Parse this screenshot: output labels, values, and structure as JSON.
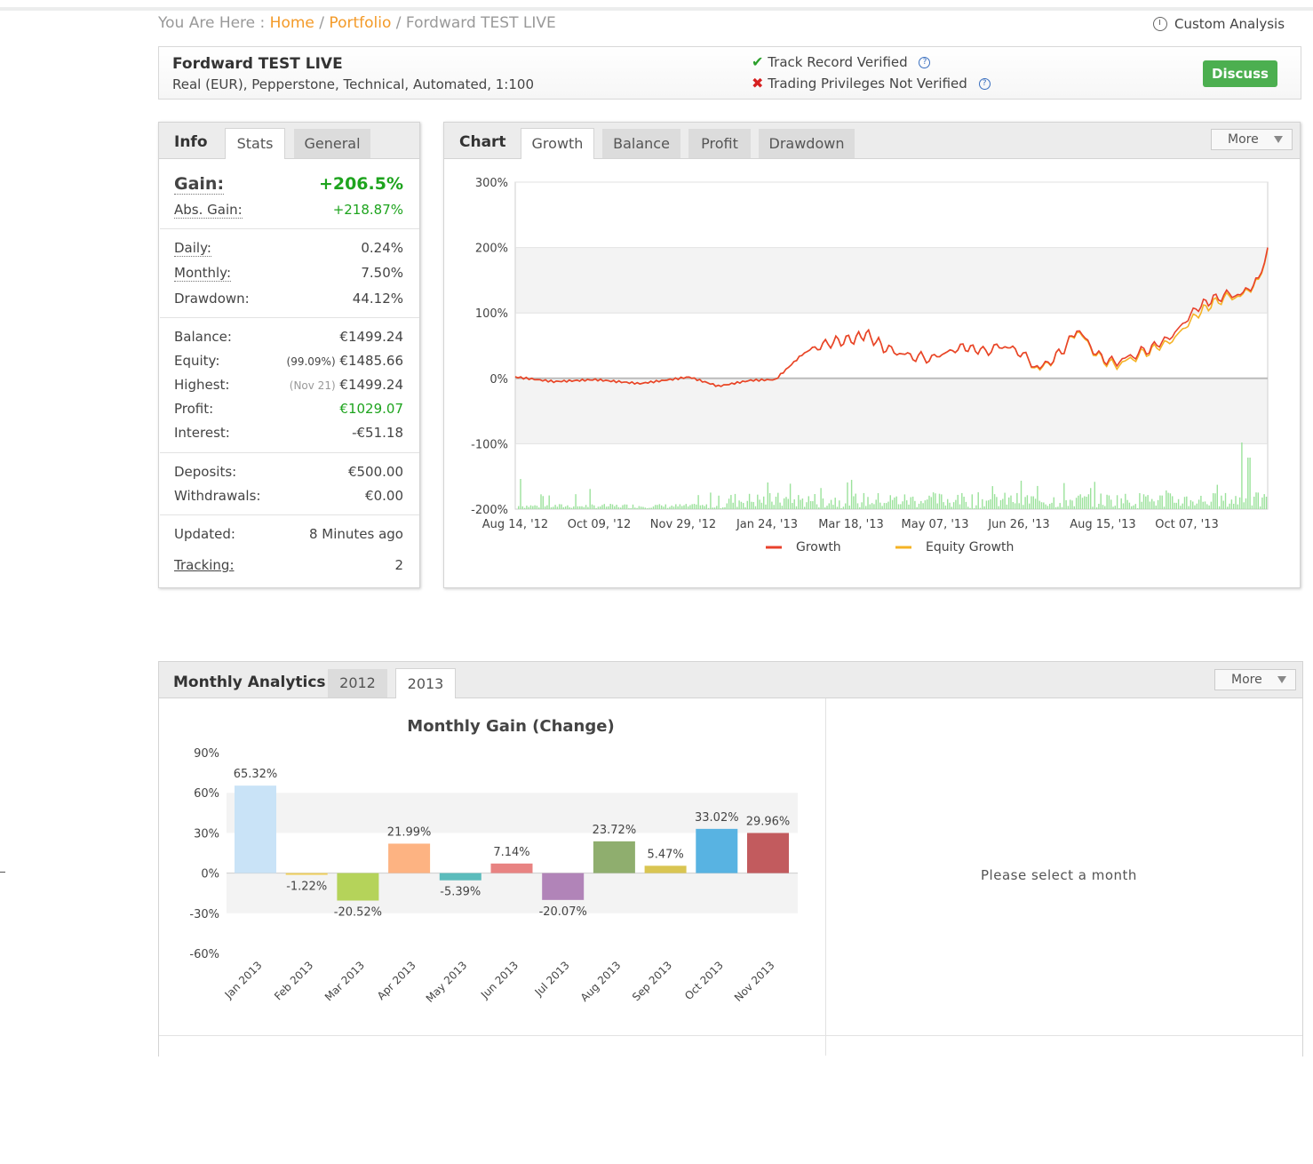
{
  "breadcrumb": {
    "prefix": "You Are Here : ",
    "home": "Home",
    "sep": " / ",
    "portfolio": "Portfolio",
    "current": "Fordward TEST LIVE"
  },
  "custom_analysis": "Custom Analysis",
  "account": {
    "name": "Fordward TEST LIVE",
    "details": "Real (EUR), Pepperstone, Technical, Automated, 1:100",
    "track_record": "Track Record Verified",
    "trading_privileges": "Trading Privileges Not Verified",
    "discuss": "Discuss"
  },
  "info_panel": {
    "tabs": [
      "Info",
      "Stats",
      "General"
    ],
    "gain_label": "Gain:",
    "gain_value": "+206.5%",
    "abs_gain_label": "Abs. Gain:",
    "abs_gain_value": "+218.87%",
    "daily_label": "Daily:",
    "daily_value": "0.24%",
    "monthly_label": "Monthly:",
    "monthly_value": "7.50%",
    "drawdown_label": "Drawdown:",
    "drawdown_value": "44.12%",
    "balance_label": "Balance:",
    "balance_value": "€1499.24",
    "equity_label": "Equity:",
    "equity_pct": "(99.09%)",
    "equity_value": "€1485.66",
    "highest_label": "Highest:",
    "highest_date": "(Nov 21)",
    "highest_value": "€1499.24",
    "profit_label": "Profit:",
    "profit_value": "€1029.07",
    "interest_label": "Interest:",
    "interest_value": "-€51.18",
    "deposits_label": "Deposits:",
    "deposits_value": "€500.00",
    "withdrawals_label": "Withdrawals:",
    "withdrawals_value": "€0.00",
    "updated_label": "Updated:",
    "updated_value": "8 Minutes ago",
    "tracking_label": "Tracking:",
    "tracking_value": "2"
  },
  "chart_panel": {
    "title": "Chart",
    "tabs": [
      "Growth",
      "Balance",
      "Profit",
      "Drawdown"
    ],
    "more": "More"
  },
  "monthly_panel": {
    "title": "Monthly Analytics",
    "tabs": [
      "2012",
      "2013"
    ],
    "more": "More",
    "placeholder": "Please select a month"
  },
  "colors": {
    "growth": "#e8412c",
    "equity": "#f5b325",
    "bar_volume": "#9be29b",
    "green": "#1ea41e",
    "orange": "#f39a28"
  },
  "chart_data": [
    {
      "type": "line",
      "x_tick_labels": [
        "Aug 14, '12",
        "Oct 09, '12",
        "Nov 29, '12",
        "Jan 24, '13",
        "Mar 18, '13",
        "May 07, '13",
        "Jun 26, '13",
        "Aug 15, '13",
        "Oct 07, '13"
      ],
      "y_tick_labels": [
        "300%",
        "200%",
        "100%",
        "0%",
        "-100%",
        "-200%"
      ],
      "ylim": [
        -200,
        300
      ],
      "series": [
        {
          "name": "Growth",
          "color": "#e8412c",
          "x": [
            "2012-07-20",
            "2012-08-14",
            "2012-09-10",
            "2012-10-09",
            "2012-10-25",
            "2012-11-10",
            "2012-11-29",
            "2012-12-20",
            "2013-01-05",
            "2013-01-24",
            "2013-02-10",
            "2013-02-25",
            "2013-03-05",
            "2013-03-18",
            "2013-04-01",
            "2013-04-15",
            "2013-05-07",
            "2013-05-20",
            "2013-06-05",
            "2013-06-15",
            "2013-06-26",
            "2013-07-10",
            "2013-07-20",
            "2013-08-05",
            "2013-08-15",
            "2013-09-05",
            "2013-09-20",
            "2013-10-07",
            "2013-10-20",
            "2013-11-05",
            "2013-11-15",
            "2013-11-21"
          ],
          "y": [
            2,
            -5,
            -2,
            -8,
            -3,
            2,
            -12,
            -3,
            -2,
            40,
            55,
            60,
            68,
            45,
            35,
            30,
            48,
            42,
            50,
            35,
            15,
            40,
            75,
            30,
            25,
            45,
            65,
            110,
            125,
            130,
            150,
            200
          ]
        },
        {
          "name": "Equity Growth",
          "color": "#f5b325",
          "x": [
            "2012-07-20",
            "2012-08-14",
            "2012-09-10",
            "2012-10-09",
            "2012-10-25",
            "2012-11-10",
            "2012-11-29",
            "2012-12-20",
            "2013-01-05",
            "2013-01-24",
            "2013-02-10",
            "2013-02-25",
            "2013-03-05",
            "2013-03-18",
            "2013-04-01",
            "2013-04-15",
            "2013-05-07",
            "2013-05-20",
            "2013-06-05",
            "2013-06-15",
            "2013-06-26",
            "2013-07-10",
            "2013-07-20",
            "2013-08-05",
            "2013-08-15",
            "2013-09-05",
            "2013-09-20",
            "2013-10-07",
            "2013-10-20",
            "2013-11-05",
            "2013-11-15",
            "2013-11-21"
          ],
          "y": [
            2,
            -5,
            -2,
            -8,
            -3,
            2,
            -12,
            -3,
            -2,
            40,
            55,
            60,
            68,
            45,
            35,
            30,
            48,
            42,
            50,
            35,
            13,
            40,
            73,
            28,
            20,
            42,
            58,
            100,
            120,
            128,
            148,
            198
          ]
        }
      ]
    },
    {
      "type": "bar",
      "title": "Monthly Gain (Change)",
      "categories": [
        "Jan 2013",
        "Feb 2013",
        "Mar 2013",
        "Apr 2013",
        "May 2013",
        "Jun 2013",
        "Jul 2013",
        "Aug 2013",
        "Sep 2013",
        "Oct 2013",
        "Nov 2013"
      ],
      "values": [
        65.32,
        -1.22,
        -20.52,
        21.99,
        -5.39,
        7.14,
        -20.07,
        23.72,
        5.47,
        33.02,
        29.96
      ],
      "labels": [
        "65.32%",
        "-1.22%",
        "-20.52%",
        "21.99%",
        "-5.39%",
        "7.14%",
        "-20.07%",
        "23.72%",
        "5.47%",
        "33.02%",
        "29.96%"
      ],
      "colors": [
        "#c9e3f7",
        "#f0d060",
        "#b5d35a",
        "#fdb382",
        "#5bbcbc",
        "#e88382",
        "#b184b8",
        "#8fae6e",
        "#d9c552",
        "#58b3e2",
        "#c25b5e"
      ],
      "y_tick_labels": [
        "90%",
        "60%",
        "30%",
        "0%",
        "-30%",
        "-60%"
      ],
      "ylim": [
        -60,
        90
      ]
    }
  ]
}
